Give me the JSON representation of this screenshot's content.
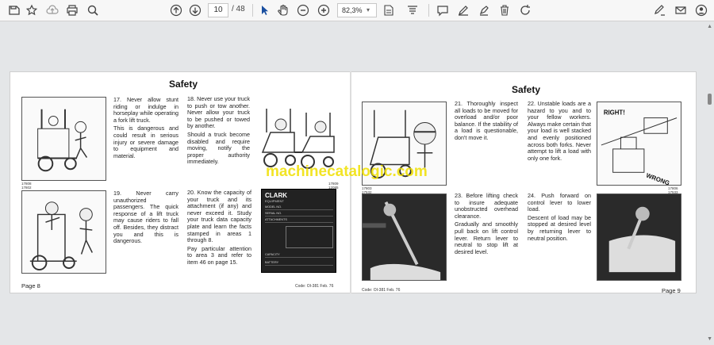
{
  "toolbar": {
    "page_current": "10",
    "page_total": "/ 48",
    "zoom": "82,3%",
    "icons": [
      "save-icon",
      "bookmark-icon",
      "upload-icon",
      "print-icon",
      "search-icon",
      "up-arrow-icon",
      "down-arrow-icon",
      "select-cursor-icon",
      "hand-icon",
      "zoom-out-icon",
      "zoom-in-icon",
      "fit-page-icon",
      "read-mode-icon",
      "comment-icon",
      "draw-icon",
      "highlight-icon",
      "delete-icon",
      "rotate-icon",
      "sign-icon",
      "mail-icon",
      "account-icon"
    ]
  },
  "watermark": "machinecatalogic.com",
  "left_page": {
    "title": "Safety",
    "item17": "17. Never allow stunt riding or indulge in horseplay while operating a fork lift truck.",
    "item17b": "This is dangerous and could result in serious injury or severe damage to equipment and material.",
    "item18": "18. Never use your truck to push or tow another. Never allow your truck to be pushed or towed by another.",
    "item18b": "Should a truck become disabled and require moving, notify the proper authority immediately.",
    "item19": "19. Never carry unauthorized passengers. The quick response of a lift truck may cause riders to fall off. Besides, they distract you and this is dangerous.",
    "item20": "20. Know the capacity of your truck and its attachment (if any) and never exceed it. Study your truck data capacity plate and learn the facts stamped in areas 1 through 8.",
    "item20b": "Pay particular attention to area 3 and refer to item 46 on page 15.",
    "fig1_code": "17808\n17802",
    "fig2_code": "17809\n12085",
    "plate_brand": "CLARK",
    "plate_sub": "EQUIPMENT",
    "plate_labels": [
      "MODEL NO.",
      "SERIAL NO.",
      "ATTACHMENTS",
      "CAPACITY",
      "BATTERY"
    ],
    "page_label": "Page 8",
    "code": "Code: OI-381 Feb. 76"
  },
  "right_page": {
    "title": "Safety",
    "item21": "21. Thoroughly inspect all loads to be moved for overload and/or poor balance. If the stability of a load is questionable, don't move it.",
    "item22": "22. Unstable loads are a hazard to you and to your fellow workers. Always make certain that your load is well stacked and evenly positioned across both forks. Never attempt to lift a load with only one fork.",
    "item23": "23. Before lifting check to insure adequate unobstructed overhead clearance.",
    "item23b": "Gradually and smoothly pull back on lift control lever. Return lever to neutral to stop lift at desired level.",
    "item24": "24. Push forward on control lever to lower load.",
    "item24b": "Descent of load may be stopped at desired level by returning lever to neutral position.",
    "fig_code_a": "17803\n17532",
    "fig_code_b": "17806\n17533",
    "right_label": "RIGHT!",
    "wrong_label": "WRONG",
    "page_label": "Page 9",
    "code": "Code: OI-381 Feb. 76"
  }
}
